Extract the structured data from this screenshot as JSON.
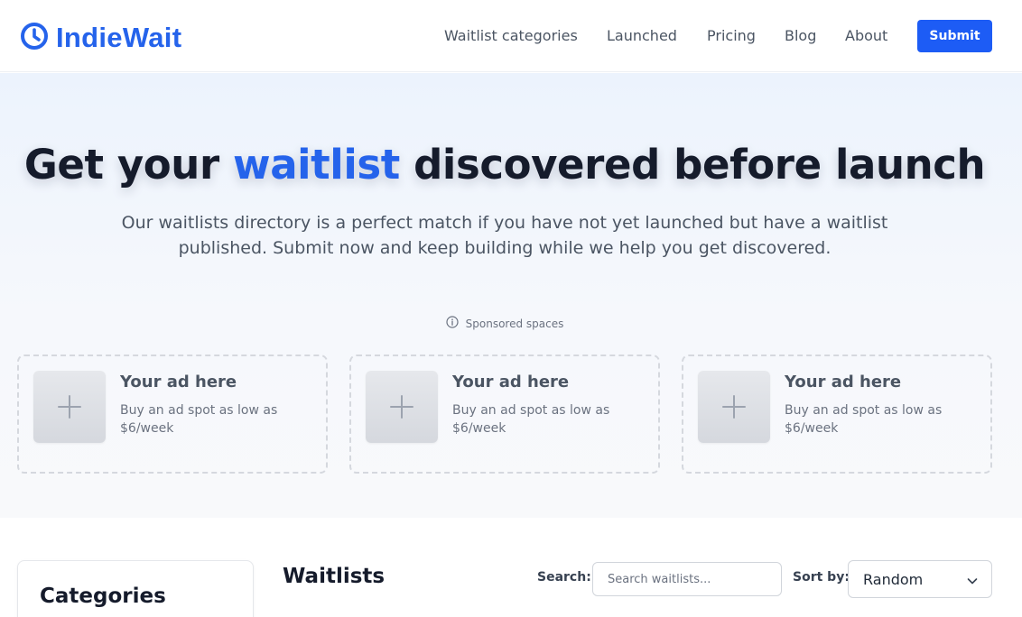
{
  "header": {
    "logo_text": "IndieWait",
    "nav": [
      {
        "label": "Waitlist categories"
      },
      {
        "label": "Launched"
      },
      {
        "label": "Pricing"
      },
      {
        "label": "Blog"
      },
      {
        "label": "About"
      }
    ],
    "submit_label": "Submit"
  },
  "hero": {
    "title_before": "Get your ",
    "title_accent": "waitlist",
    "title_after": " discovered before launch",
    "subtitle": "Our waitlists directory is a perfect match if you have not yet launched but have a waitlist published. Submit now and keep building while we help you get discovered.",
    "sponsored_label": "Sponsored spaces"
  },
  "ads": [
    {
      "title": "Your ad here",
      "desc": "Buy an ad spot as low as $6/week"
    },
    {
      "title": "Your ad here",
      "desc": "Buy an ad spot as low as $6/week"
    },
    {
      "title": "Your ad here",
      "desc": "Buy an ad spot as low as $6/week"
    }
  ],
  "main": {
    "categories_title": "Categories",
    "waitlists_title": "Waitlists",
    "search_label": "Search:",
    "search_placeholder": "Search waitlists...",
    "sort_label": "Sort by:",
    "sort_value": "Random"
  },
  "colors": {
    "accent": "#2563eb",
    "button": "#1d5cf5",
    "heading": "#151b2b"
  },
  "icons": {
    "logo": "clock-icon",
    "sponsored": "info-icon",
    "ad_thumb": "plus-icon",
    "sort": "chevron-down-icon"
  }
}
